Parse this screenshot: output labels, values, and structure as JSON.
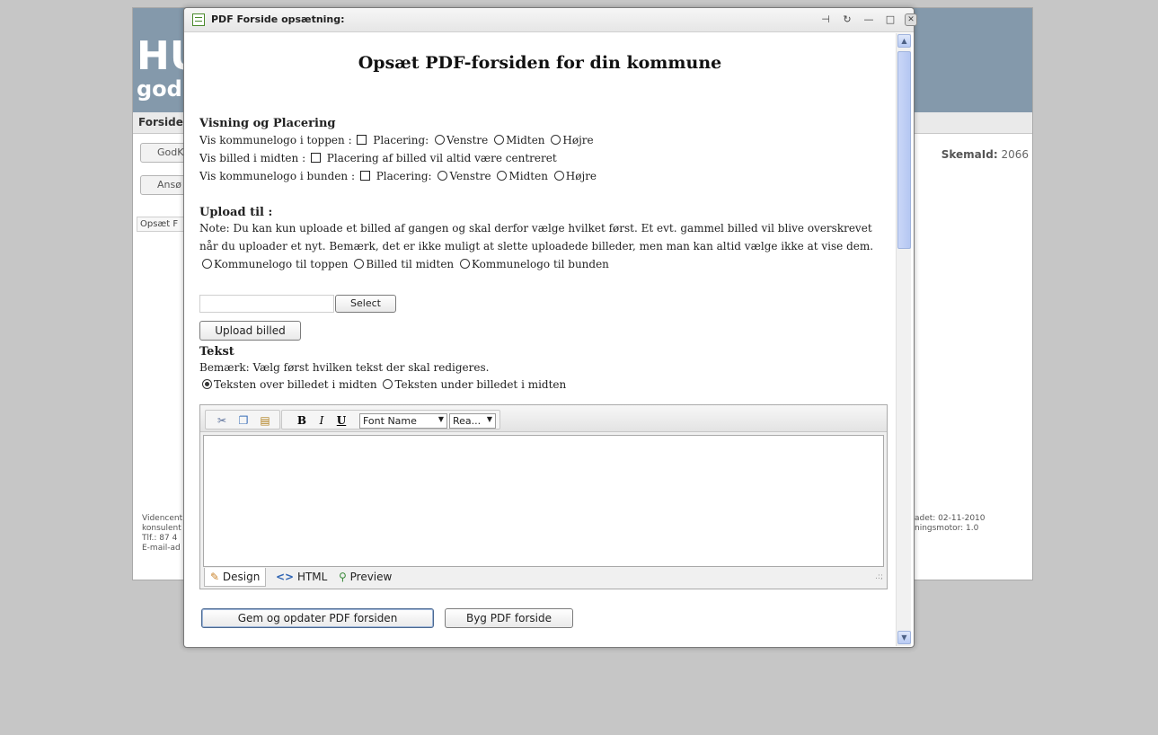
{
  "background": {
    "logo": "HU",
    "logo_sub": "god",
    "nav_item": "Forside",
    "buttons": [
      "GodK",
      "Ansø"
    ],
    "link": "Opsæt F",
    "skema_label": "SkemaId:",
    "skema_value": "2066",
    "footer_left": [
      "Videncent",
      "konsulent",
      "Tlf.: 87 4",
      "E-mail-ad"
    ],
    "footer_right": [
      "adet: 02-11-2010",
      "ningsmotor: 1.0"
    ]
  },
  "modal": {
    "title": "PDF Forside opsætning:",
    "heading": "Opsæt PDF-forsiden for din kommune",
    "display": {
      "section_title": "Visning og Placering",
      "row_top_label": "Vis kommunelogo i toppen :",
      "row_middle_label": "Vis billed i midten :",
      "row_middle_note": "Placering af billed vil altid være centreret",
      "row_bottom_label": "Vis kommunelogo i bunden :",
      "placement_label": "Placering:",
      "options": [
        "Venstre",
        "Midten",
        "Højre"
      ]
    },
    "upload": {
      "section_title": "Upload til :",
      "note_line1": "Note: Du kan kun uploade et billed af gangen og skal derfor vælge hvilket først. Et evt. gammel billed vil blive overskrevet",
      "note_line2": "når du uploader et nyt. Bemærk, det er ikke muligt at slette uploadede billeder, men man kan altid vælge ikke at vise dem.",
      "targets": [
        "Kommunelogo til toppen",
        "Billed til midten",
        "Kommunelogo til bunden"
      ],
      "select_button": "Select",
      "upload_button": "Upload billed"
    },
    "text": {
      "section_title": "Tekst",
      "note": "Bemærk: Vælg først hvilken tekst der skal redigeres.",
      "options": [
        "Teksten over billedet i midten",
        "Teksten under billedet i midten"
      ],
      "selected_index": 0
    },
    "editor": {
      "font_name": "Font Name",
      "font_size": "Rea...",
      "bold": "B",
      "italic": "I",
      "underline": "U",
      "modes": [
        "Design",
        "HTML",
        "Preview"
      ]
    },
    "actions": {
      "save": "Gem og opdater PDF forsiden",
      "build": "Byg PDF forside"
    }
  }
}
